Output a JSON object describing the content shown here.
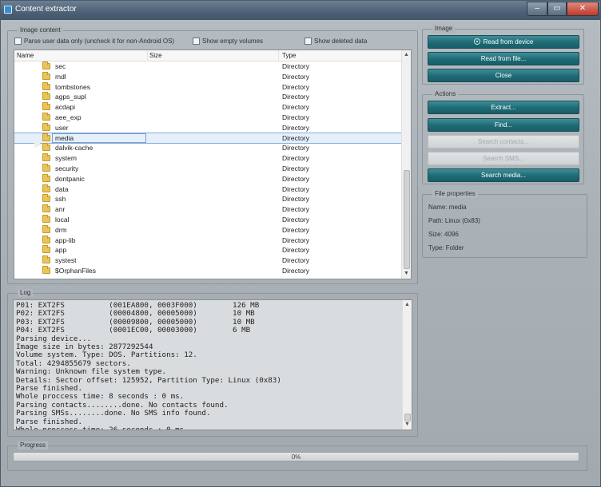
{
  "window": {
    "title": "Content extractor",
    "min_glyph": "–",
    "max_glyph": "▭",
    "close_glyph": "✕",
    "icon": "app-icon"
  },
  "image_content": {
    "group_title": "Image content",
    "options": [
      {
        "label": "Parse user data only (uncheck it for non-Android OS)",
        "checked": false
      },
      {
        "label": "Show empty volumes",
        "checked": false
      },
      {
        "label": "Show deleted data",
        "checked": false
      }
    ],
    "columns": {
      "name": "Name",
      "size": "Size",
      "type": "Type"
    },
    "rows": [
      {
        "name": "sec",
        "type": "Directory"
      },
      {
        "name": "mdl",
        "type": "Directory"
      },
      {
        "name": "tombstones",
        "type": "Directory"
      },
      {
        "name": "agps_supl",
        "type": "Directory"
      },
      {
        "name": "acdapi",
        "type": "Directory"
      },
      {
        "name": "aee_exp",
        "type": "Directory"
      },
      {
        "name": "user",
        "type": "Directory"
      },
      {
        "name": "media",
        "type": "Directory",
        "selected": true
      },
      {
        "name": "dalvik-cache",
        "type": "Directory"
      },
      {
        "name": "system",
        "type": "Directory"
      },
      {
        "name": "security",
        "type": "Directory"
      },
      {
        "name": "dontpanic",
        "type": "Directory"
      },
      {
        "name": "data",
        "type": "Directory"
      },
      {
        "name": "ssh",
        "type": "Directory"
      },
      {
        "name": "anr",
        "type": "Directory"
      },
      {
        "name": "local",
        "type": "Directory"
      },
      {
        "name": "drm",
        "type": "Directory"
      },
      {
        "name": "app-lib",
        "type": "Directory"
      },
      {
        "name": "app",
        "type": "Directory"
      },
      {
        "name": "systest",
        "type": "Directory"
      },
      {
        "name": "$OrphanFiles",
        "type": "Directory"
      }
    ],
    "scroll_up": "▲",
    "scroll_down": "▼"
  },
  "image": {
    "group_title": "Image",
    "read_from_device": "Read from device",
    "read_from_file": "Read from file...",
    "close": "Close"
  },
  "actions": {
    "group_title": "Actions",
    "extract": "Extract...",
    "find": "Find...",
    "search_contacts": "Search contacts...",
    "search_sms": "Search SMS...",
    "search_media": "Search media..."
  },
  "file_properties": {
    "group_title": "File properties",
    "name": "Name: media",
    "path": "Path: Linux (0x83)",
    "size": "Size: 4096",
    "type": "Type: Folder"
  },
  "log": {
    "group_title": "Log",
    "lines": [
      "P01: EXT2FS          (001EA800, 0003F000)        126 MB",
      "P02: EXT2FS          (00004800, 00005000)        10 MB",
      "P03: EXT2FS          (00009800, 00005000)        10 MB",
      "P04: EXT2FS          (0001EC00, 00003000)        6 MB",
      "Parsing device...",
      "Image size in bytes: 2877292544",
      "Volume system. Type: DOS. Partitions: 12.",
      "Total: 4294855679 sectors.",
      "Warning: Unknown file system type.",
      "Details: Sector offset: 125952, Partition Type: Linux (0x83)",
      "Parse finished.",
      "Whole proccess time: 8 seconds : 0 ms.",
      "Parsing contacts........done. No contacts found.",
      "Parsing SMSs........done. No SMS info found.",
      "Parse finished.",
      "Whole proccess time: 26 seconds : 0 ms."
    ]
  },
  "progress": {
    "group_title": "Progress",
    "value_percent": 0,
    "label": "0%"
  }
}
